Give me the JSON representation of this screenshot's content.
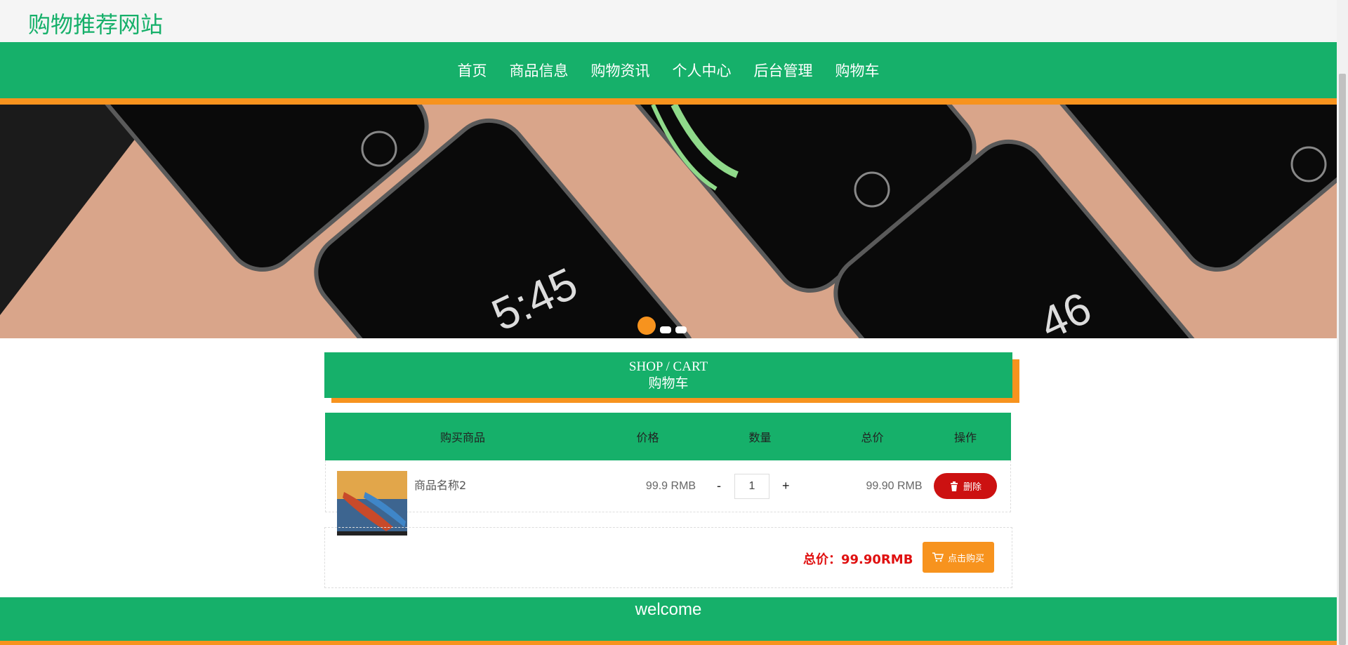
{
  "site": {
    "title": "购物推荐网站"
  },
  "nav": {
    "items": [
      {
        "label": "首页"
      },
      {
        "label": "商品信息"
      },
      {
        "label": "购物资讯"
      },
      {
        "label": "个人中心"
      },
      {
        "label": "后台管理"
      },
      {
        "label": "购物车"
      }
    ]
  },
  "banner": {
    "slide_count": 3,
    "active_slide": 1
  },
  "section": {
    "title_en": "SHOP / CART",
    "title_cn": "购物车"
  },
  "cart": {
    "headers": [
      "购买商品",
      "价格",
      "数量",
      "总价",
      "操作"
    ],
    "rows": [
      {
        "name": "商品名称2",
        "price": "99.9 RMB",
        "qty_minus": "-",
        "quantity": "1",
        "qty_plus": "+",
        "total": "99.90 RMB",
        "delete_label": "删除"
      }
    ],
    "grand_total": "总价：99.90RMB",
    "buy_label": "点击购买"
  },
  "footer": {
    "text": "welcome"
  },
  "colors": {
    "primary": "#16b06a",
    "accent": "#f7931e",
    "danger": "#cc1111",
    "total": "#e01010"
  },
  "icons": {
    "delete": "trash-icon",
    "buy": "cart-icon"
  }
}
